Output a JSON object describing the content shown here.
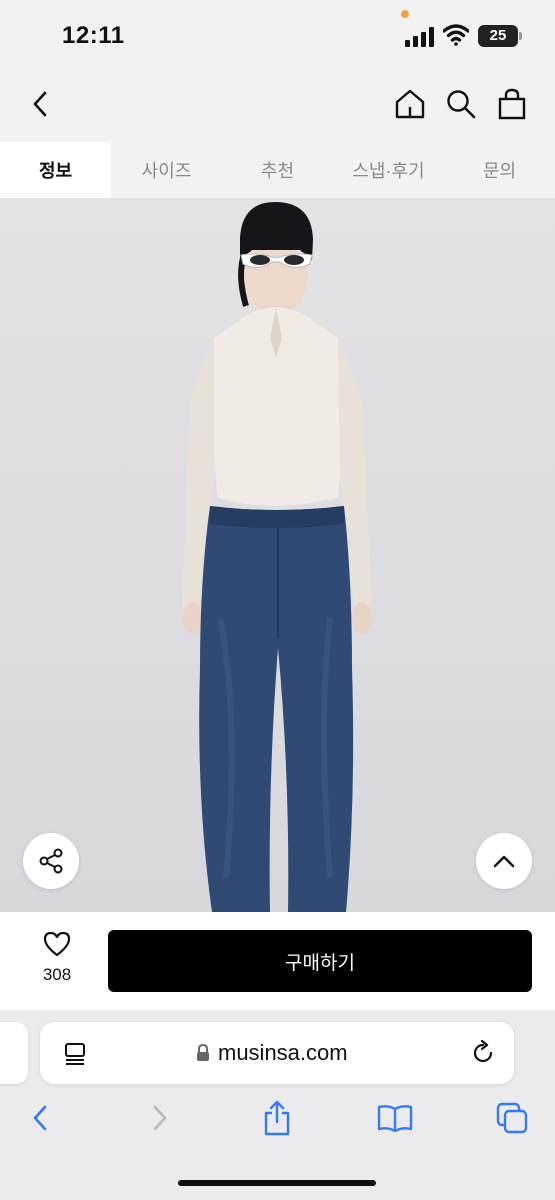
{
  "status_bar": {
    "time": "12:11",
    "battery": "25"
  },
  "header": {
    "back_icon": "chevron-left-icon",
    "home_icon": "home-icon",
    "search_icon": "search-icon",
    "cart_icon": "shopping-bag-icon"
  },
  "tabs": [
    {
      "label": "정보",
      "active": true
    },
    {
      "label": "사이즈",
      "active": false
    },
    {
      "label": "추천",
      "active": false
    },
    {
      "label": "스냅·후기",
      "active": false
    },
    {
      "label": "문의",
      "active": false
    }
  ],
  "product": {
    "share_icon": "share-icon",
    "scroll_top_icon": "chevron-up-icon"
  },
  "purchase": {
    "like_icon": "heart-icon",
    "like_count": "308",
    "buy_label": "구매하기"
  },
  "safari": {
    "url": "musinsa.com",
    "reader_icon": "page-menu-icon",
    "reload_icon": "reload-icon",
    "toolbar": [
      "back-icon",
      "forward-icon",
      "share-icon",
      "bookmarks-icon",
      "tabs-icon"
    ]
  },
  "colors": {
    "accent": "#000000",
    "background": "#f2f2f2",
    "tab_inactive_text": "#8a8a8a",
    "safari_blue": "#3478f6"
  }
}
